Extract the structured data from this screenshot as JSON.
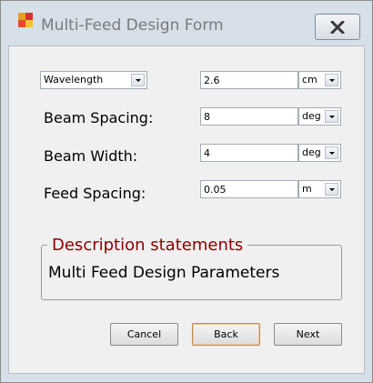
{
  "window": {
    "title": "Multi-Feed Design Form",
    "icon": "app-icon",
    "close_icon": "close-x-icon"
  },
  "form": {
    "parameter_select": {
      "value": "Wavelength"
    },
    "wavelength": {
      "value": "2.6",
      "unit": "cm"
    },
    "beam_spacing": {
      "label": "Beam Spacing:",
      "value": "8",
      "unit": "deg"
    },
    "beam_width": {
      "label": "Beam Width:",
      "value": "4",
      "unit": "deg"
    },
    "feed_spacing": {
      "label": "Feed Spacing:",
      "value": "0.05",
      "unit": "m"
    }
  },
  "description": {
    "title": "Description statements",
    "text": "Multi Feed Design Parameters"
  },
  "buttons": {
    "cancel": "Cancel",
    "back": "Back",
    "next": "Next"
  },
  "colors": {
    "group_title": "#8b0000",
    "window_frame": "#d7dfe9",
    "client_bg": "#f0f0f0"
  }
}
